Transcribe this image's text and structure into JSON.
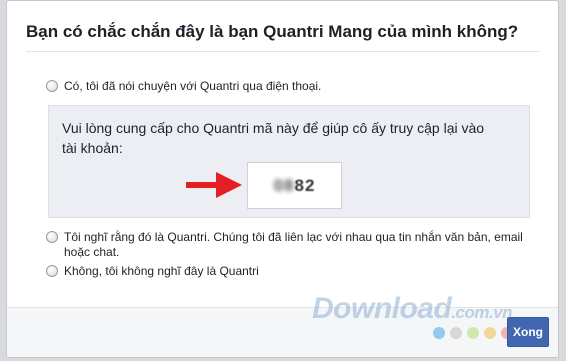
{
  "dialog": {
    "title": "Bạn có chắc chắn đây là bạn Quantri Mang của mình không?",
    "options": [
      {
        "label": "Có, tôi đã nói chuyện với Quantri qua điện thoại."
      },
      {
        "label": "Tôi nghĩ rằng đó là Quantri. Chúng tôi đã liên lạc với nhau qua tin nhắn văn bản, email hoặc chat."
      },
      {
        "label": "Không, tôi không nghĩ đây là Quantri"
      }
    ],
    "panel": {
      "text": "Vui lòng cung cấp cho Quantri mã này để giúp cô ấy truy cập lại vào tài khoản:",
      "code_hidden": "08",
      "code_visible": "82"
    },
    "done_label": "Xong"
  },
  "watermark": {
    "brand": "Download",
    "domain": ".com.vn"
  },
  "colors": {
    "primary_button": "#4267b2",
    "arrow": "#e31e24",
    "panel_bg": "#eceef3"
  },
  "decor_dots": [
    "#93c9ec",
    "#d7d7d7",
    "#cfe8b0",
    "#f3d79a",
    "#f3b3b3"
  ]
}
